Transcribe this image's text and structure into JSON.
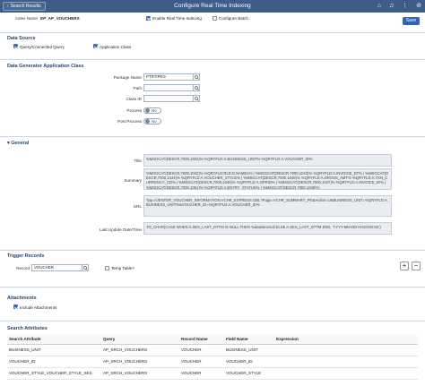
{
  "header": {
    "back_label": "Search Results",
    "title": "Configure Real Time Indexing",
    "icons": [
      "home-icon",
      "bell-icon",
      "more-icon",
      "compass-icon"
    ]
  },
  "index": {
    "name_label": "Index Name",
    "name_value": "EP_AP_VOUCHERS",
    "enable_rti_label": "Enable Real Time Indexing",
    "enable_rti_checked": true,
    "configure_batch_label": "Configure Batch",
    "configure_batch_checked": false,
    "save_label": "Save"
  },
  "data_source": {
    "title": "Data Source",
    "query_label": "Query/Connected Query",
    "query_checked": true,
    "app_class_label": "Application Class",
    "app_class_checked": true
  },
  "generator": {
    "title": "Data Generator Application Class",
    "package_label": "Package Name",
    "package_value": "PTRTIPKG",
    "path_label": "Path",
    "path_value": "",
    "class_label": "Class ID",
    "class_value": "",
    "process_label": "Process",
    "process_toggle": "No",
    "post_process_label": "Post Process",
    "post_process_toggle": "No"
  },
  "general": {
    "title": "General",
    "title_label": "Title",
    "title_value": "%MSGCAT(DESCR,7000,1002)% %QRYFLD:A.BUSINESS_UNIT% %QRYFLD:A.VOUCHER_ID%",
    "summary_label": "Summary",
    "summary_value": "%MSGCAT(DESCR,7000,1042)% %QRYFLD:RLR.D.NAME1% | %MSGCAT(DESCR,7000,1043)% %QRYFLD:A.INVOICE_DT% | %MSGCAT(DESCR,7000,1044)% %QRYFLD:A.VOUCHER_STYLE% | %MSGCAT(DESCR,7000,1045)% %QRYFLD:A.GROSS_AMT% %QRYFLD:A.TXN_CURRENCY_CD% | %MSGCAT(DESCR,7000,1046)% %QRYFLD:A.OPRID% | %MSGCAT(DESCR,7000,1047)% %QRYFLD:A.INVOICE_ID% | %MSGCAT(DESCR,7000,1051)% %QRYFLD:A.ENTRY_STATUS% | %MSGCAT(DESCR,7000,1048)%",
    "url_label": "URL",
    "url_value": "?pp=/c/ENTER_VOUCHER_INFORMATION.VCHR_EXPRESS.GBL?Page=VCHR_SUMMARY_PG&Action=U&BUSINESS_UNIT=%QRYFLD:A.BUSINESS_UNIT%&VOUCHER_ID=%QRYFLD:A.VOUCHER_ID%",
    "last_update_label": "Last Update Date/Time",
    "last_update_value": "TO_CHAR(CASE WHEN A.SES_LAST_DTTM IS NULL THEN %datetimenull ELSE A.SES_LAST_DTTM END, 'YYYY-MM-DD HH24:MI:SS')"
  },
  "trigger": {
    "title": "Trigger Records",
    "record_label": "Record",
    "record_value": "VOUCHER",
    "temp_table_label": "Temp Table?",
    "temp_table_checked": false,
    "add_label": "+",
    "remove_label": "−"
  },
  "attachments": {
    "title": "Attachments",
    "include_label": "Include Attachments",
    "include_checked": true
  },
  "search_attrs": {
    "title": "Search Attributes",
    "columns": [
      "Search Attribute",
      "Query",
      "Record Name",
      "Field Name",
      "Expression"
    ],
    "rows": [
      [
        "BUSINESS_UNIT",
        "AP_SRCH_VOUCHERS",
        "VOUCHER",
        "BUSINESS_UNIT",
        ""
      ],
      [
        "VOUCHER_ID",
        "AP_SRCH_VOUCHERS",
        "VOUCHER",
        "VOUCHER_ID",
        ""
      ],
      [
        "VOUCHER_STYLE_VOUCHER_STYLE_SES",
        "AP_SRCH_VOUCHERS",
        "VOUCHER",
        "VOUCHER_STYLE",
        ""
      ]
    ]
  }
}
